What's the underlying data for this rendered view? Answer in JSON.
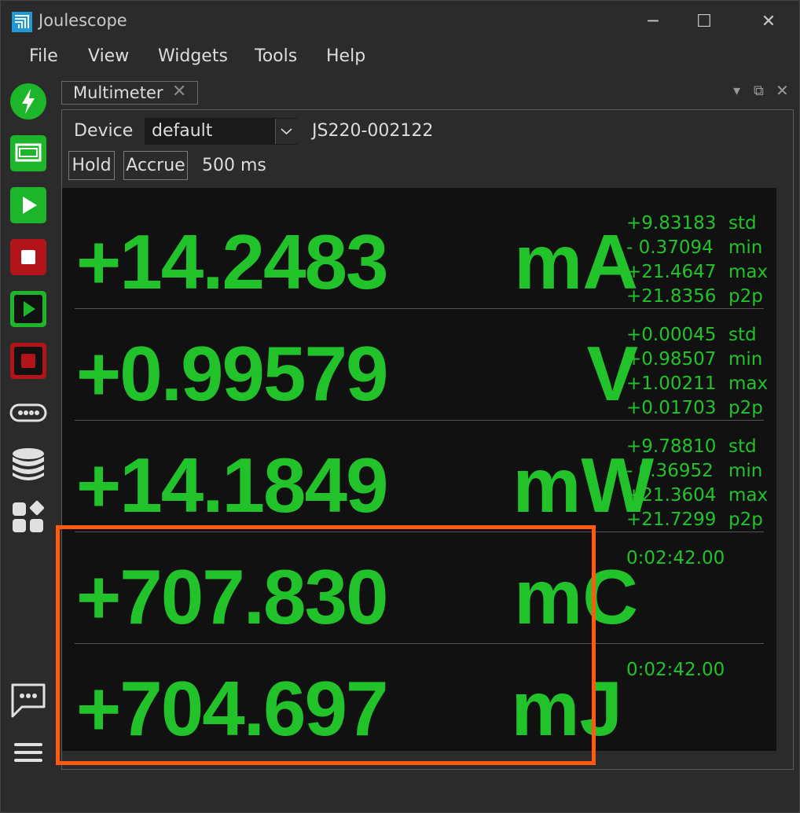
{
  "window": {
    "title": "Joulescope",
    "controls": [
      "minimize-icon",
      "maximize-icon",
      "close-icon"
    ]
  },
  "menu": {
    "items": [
      "File",
      "View",
      "Widgets",
      "Tools",
      "Help"
    ]
  },
  "toolbar": {
    "icons": [
      "lightning-icon",
      "device-window-icon",
      "play-icon",
      "stop-icon",
      "play-record-icon",
      "stop-record-icon",
      "more-icon",
      "database-icon",
      "widgets-icon",
      "chat-icon",
      "menu-icon"
    ]
  },
  "dock": {
    "tab_label": "Multimeter",
    "tab_close": "✕"
  },
  "controls": {
    "device_label": "Device",
    "device_value": "default",
    "serial": "JS220-002122",
    "hold_label": "Hold",
    "accrue_label": "Accrue",
    "interval": "500 ms"
  },
  "readings": [
    {
      "value": "+14.2483",
      "unit": "mA",
      "stats": [
        {
          "value": "+9.83183",
          "label": "std"
        },
        {
          "value": "- 0.37094",
          "label": "min"
        },
        {
          "value": "+21.4647",
          "label": "max"
        },
        {
          "value": "+21.8356",
          "label": "p2p"
        }
      ]
    },
    {
      "value": "+0.99579",
      "unit": "V",
      "stats": [
        {
          "value": "+0.00045",
          "label": "std"
        },
        {
          "value": "+0.98507",
          "label": "min"
        },
        {
          "value": "+1.00211",
          "label": "max"
        },
        {
          "value": "+0.01703",
          "label": "p2p"
        }
      ]
    },
    {
      "value": "+14.1849",
      "unit": "mW",
      "stats": [
        {
          "value": "+9.78810",
          "label": "std"
        },
        {
          "value": "- 0.36952",
          "label": "min"
        },
        {
          "value": "+21.3604",
          "label": "max"
        },
        {
          "value": "+21.7299",
          "label": "p2p"
        }
      ]
    },
    {
      "value": "+707.830",
      "unit": "mC",
      "stats": [
        {
          "value": "0:02:42.00",
          "label": ""
        }
      ]
    },
    {
      "value": "+704.697",
      "unit": "mJ",
      "stats": [
        {
          "value": "0:02:42.00",
          "label": ""
        }
      ]
    }
  ],
  "colors": {
    "reading": "#22c32a",
    "highlight": "#ff5a10",
    "background": "#111111"
  }
}
